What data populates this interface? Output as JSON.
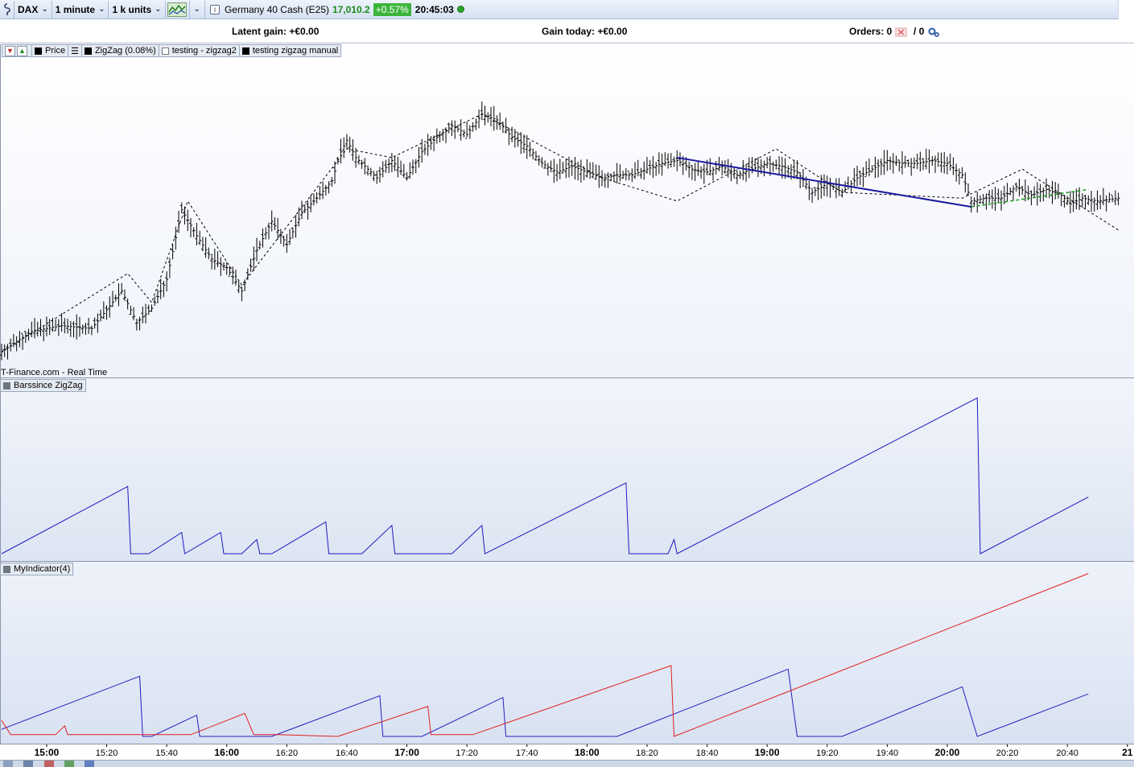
{
  "toolbar": {
    "instrument_select": "DAX",
    "timeframe_select": "1 minute",
    "units_select": "1 k units",
    "info_icon": "info-icon",
    "instrument_name": "Germany 40 Cash (E25)",
    "price": "17,010.2",
    "change": "+0.57%",
    "time": "20:45:03",
    "status_color": "#2aa52a"
  },
  "stats": {
    "latent_gain": "Latent gain: +€0.00",
    "gain_today": "Gain today: +€0.00",
    "orders_label": "Orders: 0",
    "orders_pending": "/ 0"
  },
  "price_legend": {
    "price": "Price",
    "zigzag": "ZigZag (0.08%)",
    "testing_zigzag2": "testing - zigzag2",
    "testing_manual": "testing zigzag manual"
  },
  "source": "IT-Finance.com - Real Time",
  "barssince_legend": "Barssince ZigZag",
  "myindicator_legend": "MyIndicator(4)",
  "xaxis": {
    "labels": [
      {
        "t": "15:00",
        "bold": true
      },
      {
        "t": "15:20",
        "bold": false
      },
      {
        "t": "15:40",
        "bold": false
      },
      {
        "t": "16:00",
        "bold": true
      },
      {
        "t": "16:20",
        "bold": false
      },
      {
        "t": "16:40",
        "bold": false
      },
      {
        "t": "17:00",
        "bold": true
      },
      {
        "t": "17:20",
        "bold": false
      },
      {
        "t": "17:40",
        "bold": false
      },
      {
        "t": "18:00",
        "bold": true
      },
      {
        "t": "18:20",
        "bold": false
      },
      {
        "t": "18:40",
        "bold": false
      },
      {
        "t": "19:00",
        "bold": true
      },
      {
        "t": "19:20",
        "bold": false
      },
      {
        "t": "19:40",
        "bold": false
      },
      {
        "t": "20:00",
        "bold": true
      },
      {
        "t": "20:20",
        "bold": false
      },
      {
        "t": "20:40",
        "bold": false
      },
      {
        "t": "21",
        "bold": true
      }
    ]
  },
  "chart_data": [
    {
      "type": "line",
      "name": "price",
      "x_unit": "minutes since 14:45",
      "ylim": [
        0,
        100
      ],
      "zigzag_dashed": [
        [
          0,
          5
        ],
        [
          42,
          32
        ],
        [
          50,
          22
        ],
        [
          62,
          57
        ],
        [
          80,
          28
        ],
        [
          115,
          75
        ],
        [
          130,
          72
        ],
        [
          160,
          87
        ],
        [
          200,
          65
        ],
        [
          225,
          57
        ],
        [
          258,
          75
        ],
        [
          280,
          60
        ],
        [
          320,
          58
        ],
        [
          340,
          68
        ],
        [
          372,
          47
        ]
      ],
      "close": [
        [
          0,
          5
        ],
        [
          10,
          12
        ],
        [
          20,
          14
        ],
        [
          30,
          13
        ],
        [
          40,
          26
        ],
        [
          45,
          15
        ],
        [
          50,
          20
        ],
        [
          55,
          30
        ],
        [
          60,
          54
        ],
        [
          65,
          45
        ],
        [
          70,
          37
        ],
        [
          75,
          34
        ],
        [
          80,
          26
        ],
        [
          85,
          40
        ],
        [
          90,
          50
        ],
        [
          95,
          42
        ],
        [
          100,
          53
        ],
        [
          105,
          58
        ],
        [
          110,
          64
        ],
        [
          113,
          74
        ],
        [
          115,
          78
        ],
        [
          118,
          72
        ],
        [
          125,
          65
        ],
        [
          130,
          71
        ],
        [
          135,
          65
        ],
        [
          140,
          74
        ],
        [
          145,
          79
        ],
        [
          150,
          83
        ],
        [
          155,
          80
        ],
        [
          160,
          87
        ],
        [
          165,
          85
        ],
        [
          170,
          79
        ],
        [
          175,
          76
        ],
        [
          180,
          70
        ],
        [
          185,
          67
        ],
        [
          190,
          69
        ],
        [
          200,
          65
        ],
        [
          205,
          66
        ],
        [
          210,
          66
        ],
        [
          215,
          68
        ],
        [
          220,
          70
        ],
        [
          225,
          71
        ],
        [
          230,
          68
        ],
        [
          235,
          67
        ],
        [
          240,
          69
        ],
        [
          245,
          66
        ],
        [
          250,
          68
        ],
        [
          255,
          70
        ],
        [
          260,
          69
        ],
        [
          265,
          67
        ],
        [
          270,
          60
        ],
        [
          275,
          63
        ],
        [
          280,
          60
        ],
        [
          285,
          65
        ],
        [
          290,
          68
        ],
        [
          295,
          71
        ],
        [
          300,
          70
        ],
        [
          305,
          70
        ],
        [
          310,
          71
        ],
        [
          315,
          70
        ],
        [
          320,
          66
        ],
        [
          323,
          57
        ],
        [
          328,
          58
        ],
        [
          333,
          58
        ],
        [
          338,
          62
        ],
        [
          343,
          59
        ],
        [
          348,
          61
        ],
        [
          353,
          59
        ],
        [
          356,
          56
        ],
        [
          360,
          58
        ],
        [
          365,
          57
        ],
        [
          372,
          58
        ]
      ]
    },
    {
      "type": "line",
      "name": "Barssince ZigZag",
      "x_unit": "minutes since 14:45",
      "values": [
        [
          0,
          0
        ],
        [
          42,
          19
        ],
        [
          43,
          0
        ],
        [
          47,
          0
        ],
        [
          49,
          0
        ],
        [
          60,
          6
        ],
        [
          61,
          0
        ],
        [
          73,
          6
        ],
        [
          74,
          0
        ],
        [
          78,
          0
        ],
        [
          80,
          0
        ],
        [
          85,
          4
        ],
        [
          86,
          0
        ],
        [
          88,
          0
        ],
        [
          90,
          0
        ],
        [
          108,
          9
        ],
        [
          109,
          0
        ],
        [
          120,
          0
        ],
        [
          130,
          8
        ],
        [
          131,
          0
        ],
        [
          150,
          0
        ],
        [
          160,
          8
        ],
        [
          161,
          0
        ],
        [
          208,
          20
        ],
        [
          209,
          0
        ],
        [
          222,
          0
        ],
        [
          224,
          4
        ],
        [
          225,
          0
        ],
        [
          325,
          44
        ],
        [
          326,
          0
        ],
        [
          362,
          16
        ]
      ]
    },
    {
      "type": "line",
      "name": "MyIndicator(4)",
      "x_unit": "minutes since 14:45",
      "series": [
        {
          "color": "#2020c0",
          "values": [
            [
              0,
              4
            ],
            [
              46,
              34
            ],
            [
              47,
              0
            ],
            [
              50,
              0
            ],
            [
              65,
              12
            ],
            [
              66,
              0
            ],
            [
              70,
              0
            ],
            [
              90,
              0
            ],
            [
              126,
              23
            ],
            [
              127,
              0
            ],
            [
              130,
              0
            ],
            [
              135,
              0
            ],
            [
              140,
              0
            ],
            [
              167,
              22
            ],
            [
              168,
              0
            ],
            [
              170,
              0
            ],
            [
              180,
              0
            ],
            [
              185,
              0
            ],
            [
              190,
              0
            ],
            [
              205,
              0
            ],
            [
              262,
              38
            ],
            [
              265,
              0
            ],
            [
              275,
              0
            ],
            [
              280,
              0
            ],
            [
              320,
              28
            ],
            [
              325,
              0
            ],
            [
              362,
              24
            ]
          ]
        },
        {
          "color": "#e02020",
          "values": [
            [
              0,
              9
            ],
            [
              3,
              1
            ],
            [
              8,
              1
            ],
            [
              18,
              1
            ],
            [
              21,
              6
            ],
            [
              22,
              1
            ],
            [
              31,
              1
            ],
            [
              33,
              1
            ],
            [
              40,
              1
            ],
            [
              45,
              1
            ],
            [
              58,
              1
            ],
            [
              63,
              1
            ],
            [
              81,
              13
            ],
            [
              84,
              1
            ],
            [
              86,
              1
            ],
            [
              92,
              1
            ],
            [
              112,
              0
            ],
            [
              142,
              17
            ],
            [
              143,
              1
            ],
            [
              157,
              1
            ],
            [
              223,
              40
            ],
            [
              224,
              0
            ],
            [
              362,
              92
            ]
          ]
        }
      ]
    }
  ]
}
